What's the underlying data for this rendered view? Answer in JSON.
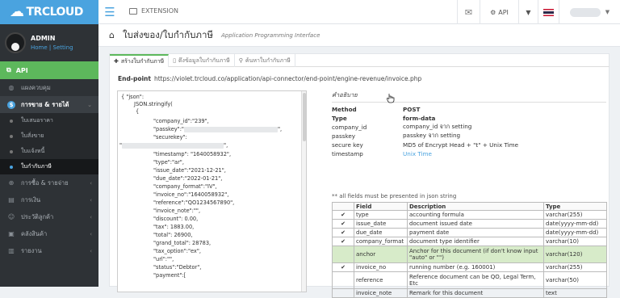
{
  "topbar": {
    "brand": "TRCLOUD",
    "extension_label": "EXTENSION",
    "api_label": "API"
  },
  "sidebar": {
    "user_name": "ADMIN",
    "home_link": "Home",
    "setting_link": "Setting",
    "api_label": "API",
    "items": [
      {
        "label": "แผงควบคุม",
        "icon": "dashboard-icon"
      },
      {
        "label": "การขาย & รายได้",
        "icon": "dollar-icon",
        "active": true
      },
      {
        "label": "การซื้อ & รายจ่าย",
        "icon": "cart-icon"
      },
      {
        "label": "การเงิน",
        "icon": "money-icon"
      },
      {
        "label": "ประวัติลูกค้า",
        "icon": "user-icon"
      },
      {
        "label": "คลังสินค้า",
        "icon": "box-icon"
      },
      {
        "label": "รายงาน",
        "icon": "report-icon"
      }
    ],
    "subitems": [
      {
        "label": "ใบเสนอราคา"
      },
      {
        "label": "ใบสั่งขาย"
      },
      {
        "label": "ใบแจ้งหนี้"
      },
      {
        "label": "ใบกำกับภาษี",
        "selected": true
      }
    ]
  },
  "page": {
    "title": "ใบส่งของ/ใบกำกับภาษี",
    "subtitle": "Application Programming Interface",
    "tabs": [
      {
        "label": "สร้างใบกำกับภาษี",
        "icon": "plus-icon",
        "active": true
      },
      {
        "label": "ดึงข้อมูลใบกำกับภาษี",
        "icon": "document-icon"
      },
      {
        "label": "ค้นหาใบกำกับภาษี",
        "icon": "search-icon"
      }
    ],
    "endpoint_label": "End-point",
    "endpoint_url": "https://violet.trcloud.co/application/api-connector/end-point/engine-revenue/invoice.php"
  },
  "json_lines": [
    "{ \"json\":",
    "JSON.stringify(",
    "{",
    "\"company_id\":\"239\",",
    "\"passkey\":\"",
    "\",",
    "\"securekey\":",
    "\"",
    "\",",
    "\"timestamp\": \"1640058932\",",
    "\"type\":\"ar\",",
    "\"issue_date\":\"2021-12-21\",",
    "\"due_date\":\"2022-01-21\",",
    "\"company_format\":\"IV\",",
    "\"invoice_no\":\"1640058932\",",
    "\"reference\":\"QO1234567890\",",
    "\"invoice_note\":\"\",",
    "\"discount\": 0.00,",
    "\"tax\": 1883.00,",
    "\"total\": 26900,",
    "\"grand_total\": 28783,",
    "\"tax_option\":\"ex\",",
    "\"url\":\"\",",
    "\"status\":\"Debtor\",",
    "\"payment\":["
  ],
  "description": {
    "heading": "คำอธิบาย",
    "rows": [
      {
        "k": "Method",
        "v": "POST",
        "header": true
      },
      {
        "k": "Type",
        "v": "form-data",
        "header": true
      },
      {
        "k": "company_id",
        "v": "company_id จาก setting"
      },
      {
        "k": "passkey",
        "v": "passkey จาก setting"
      },
      {
        "k": "secure key",
        "v": "MD5 of Encrypt Head + \"t\" + Unix Time"
      },
      {
        "k": "timestamp",
        "v": "Unix Time",
        "link": true
      }
    ]
  },
  "fields_note": "** all fields must be presented in json string",
  "fields_table": {
    "headers": [
      "",
      "Field",
      "Description",
      "Type"
    ],
    "rows": [
      {
        "check": true,
        "field": "type",
        "desc": "accounting formula",
        "type": "varchar(255)"
      },
      {
        "check": true,
        "field": "issue_date",
        "desc": "document issued date",
        "type": "date(yyyy-mm-dd)"
      },
      {
        "check": true,
        "field": "due_date",
        "desc": "payment date",
        "type": "date(yyyy-mm-dd)"
      },
      {
        "check": true,
        "field": "company_format",
        "desc": "document type identifier",
        "type": "varchar(10)"
      },
      {
        "check": false,
        "field": "anchor",
        "desc": "Anchor for this document (if don't know input \"auto\" or \"\")",
        "type": "varchar(120)",
        "green": true
      },
      {
        "check": true,
        "field": "invoice_no",
        "desc": "running number (e.g. 160001)",
        "type": "varchar(255)"
      },
      {
        "check": false,
        "field": "reference",
        "desc": "Reference document can be QO, Legal Term, Etc",
        "type": "varchar(50)"
      },
      {
        "check": false,
        "field": "invoice_note",
        "desc": "Remark for this document",
        "type": "text"
      }
    ]
  }
}
